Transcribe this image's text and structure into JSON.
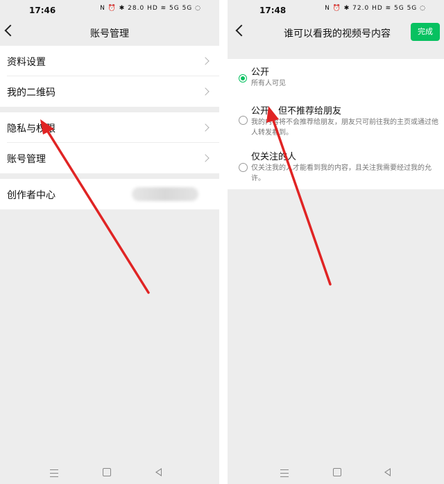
{
  "left_screen": {
    "status_bar": {
      "time": "17:46",
      "icons": "N ⏰ ✱ 28.0 HD ≋ 5G 5G ◌"
    },
    "nav": {
      "title": "账号管理"
    },
    "menu": [
      {
        "label": "资料设置"
      },
      {
        "label": "我的二维码"
      },
      {
        "label": "隐私与权限"
      },
      {
        "label": "账号管理"
      },
      {
        "label": "创作者中心"
      }
    ]
  },
  "right_screen": {
    "status_bar": {
      "time": "17:48",
      "icons": "N ⏰ ✱ 72.0 HD ≋ 5G 5G ◌"
    },
    "nav": {
      "title": "谁可以看我的视频号内容",
      "done_label": "完成"
    },
    "options": [
      {
        "title": "公开",
        "desc": "所有人可见",
        "selected": true
      },
      {
        "title": "公开，但不推荐给朋友",
        "desc": "我的内容将不会推荐给朋友，朋友只可前往我的主页或通过他人转发看到。",
        "selected": false
      },
      {
        "title": "仅关注的人",
        "desc": "仅关注我的人才能看到我的内容，且关注我需要经过我的允许。",
        "selected": false
      }
    ]
  },
  "colors": {
    "accent": "#07c160",
    "annotation_arrow": "#e02424",
    "page_bg": "#ededed"
  }
}
